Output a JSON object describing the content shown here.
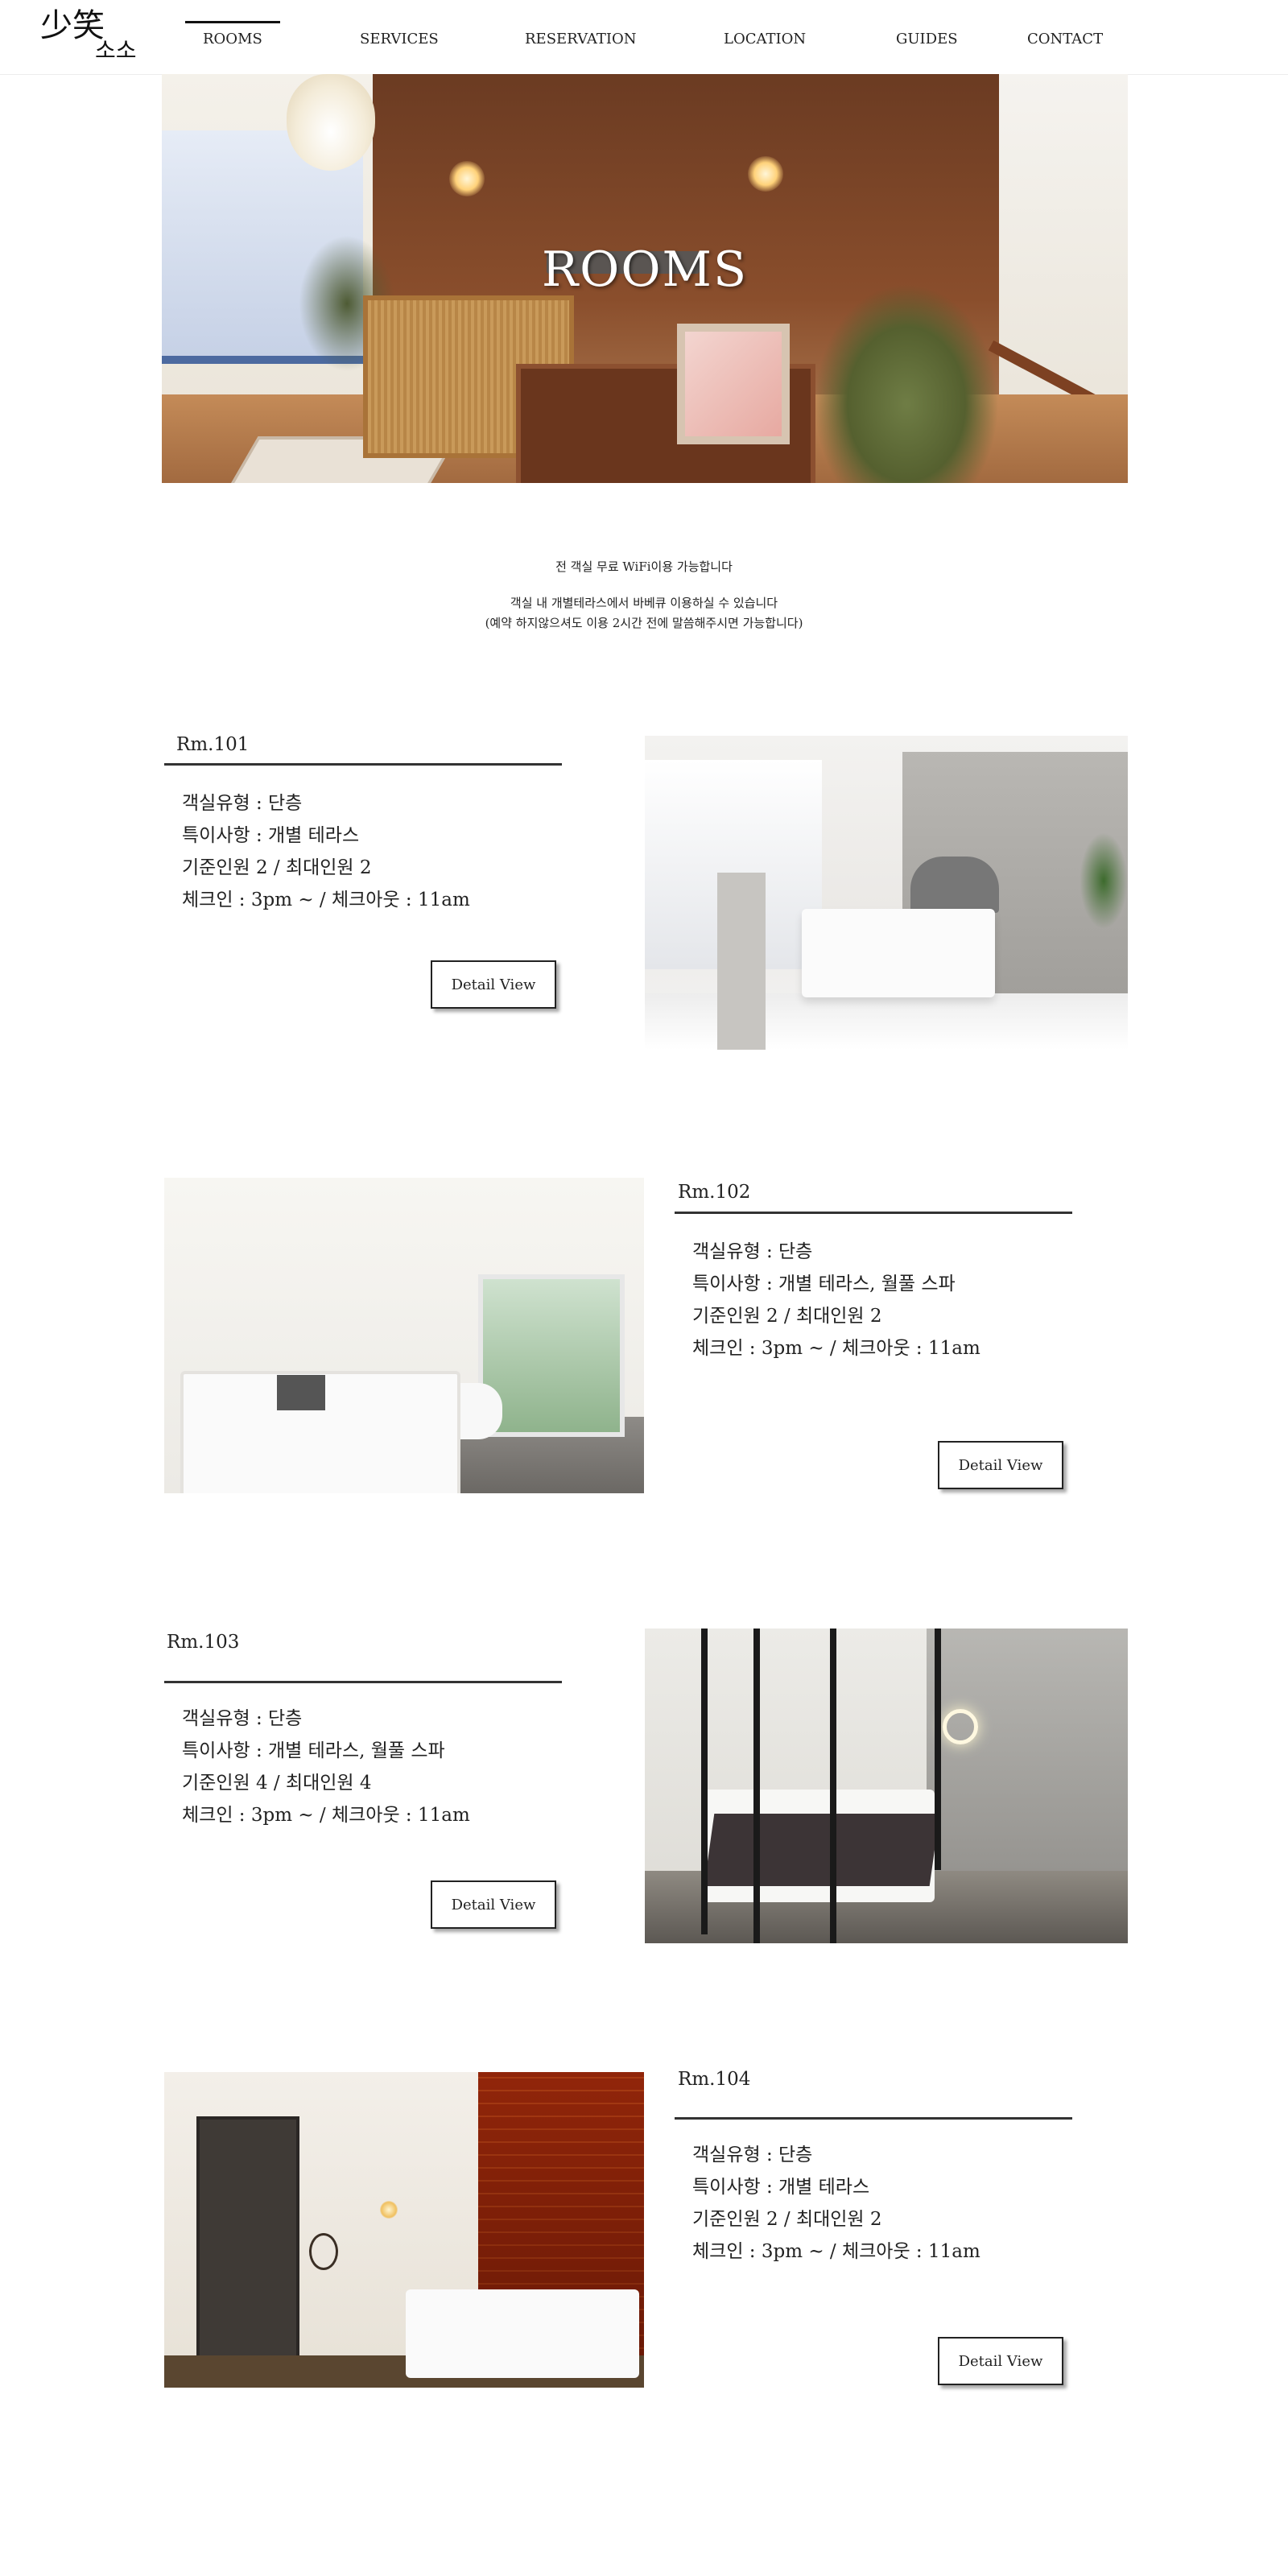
{
  "header": {
    "logo_line1": "少笑",
    "logo_line2": "소소",
    "nav": [
      "ROOMS",
      "SERVICES",
      "RESERVATION",
      "LOCATION",
      "GUIDES",
      "CONTACT"
    ],
    "active_nav": "ROOMS"
  },
  "hero": {
    "title": "ROOMS"
  },
  "intro": {
    "line1": "전 객실 무료 WiFi이용 가능합니다",
    "line2": "객실 내 개별테라스에서 바베큐 이용하실 수 있습니다",
    "line3": "(예약 하지않으셔도 이용 2시간 전에 말씀해주시면 가능합니다)"
  },
  "rooms": [
    {
      "name": "Rm.101",
      "specs": [
        "객실유형 : 단층",
        "특이사항 : 개별 테라스",
        "기준인원 2 / 최대인원 2",
        "체크인 : 3pm ~  / 체크아웃 : 11am"
      ],
      "button": "Detail View"
    },
    {
      "name": "Rm.102",
      "specs": [
        "객실유형 : 단층",
        "특이사항 : 개별 테라스, 월풀 스파",
        "기준인원 2 / 최대인원 2",
        "체크인 : 3pm ~  / 체크아웃 : 11am"
      ],
      "button": "Detail View"
    },
    {
      "name": "Rm.103",
      "specs": [
        "객실유형 : 단층",
        "특이사항 : 개별 테라스, 월풀 스파",
        "기준인원 4 / 최대인원 4",
        "체크인 : 3pm ~  / 체크아웃 : 11am"
      ],
      "button": "Detail View"
    },
    {
      "name": "Rm.104",
      "specs": [
        "객실유형 : 단층",
        "특이사항 : 개별 테라스",
        "기준인원  2 / 최대인원 2",
        "체크인 : 3pm ~  / 체크아웃 : 11am"
      ],
      "button": "Detail View"
    }
  ]
}
